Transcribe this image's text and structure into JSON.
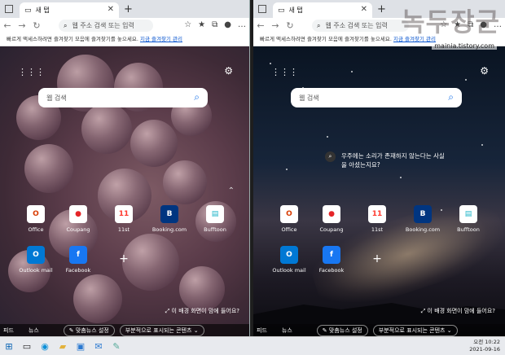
{
  "tab_title": "새 탭",
  "address_placeholder": "웹 주소 검색 또는 입력",
  "favbar_text": "빠르게 액세스하려면 즐겨찾기 모음에 즐겨찾기를 놓으세요. ",
  "favbar_link": "지금 즐겨찾기 관리",
  "search_placeholder": "웹 검색",
  "tiles": [
    {
      "label": "Office",
      "icon": "office-icon",
      "color": "#d83b01",
      "glyph": "O"
    },
    {
      "label": "Coupang",
      "icon": "coupang-icon",
      "color": "#e52528",
      "glyph": "●"
    },
    {
      "label": "11st",
      "icon": "11st-icon",
      "color": "#ff3b30",
      "glyph": "11"
    },
    {
      "label": "Booking.com",
      "icon": "booking-icon",
      "color": "#003580",
      "glyph": "B"
    },
    {
      "label": "Bufftoon",
      "icon": "bufftoon-icon",
      "color": "#1fb5c8",
      "glyph": "▤"
    },
    {
      "label": "Outlook mail",
      "icon": "outlook-icon",
      "color": "#0078d4",
      "glyph": "O"
    },
    {
      "label": "Facebook",
      "icon": "facebook-icon",
      "color": "#1877f2",
      "glyph": "f"
    }
  ],
  "caption": "이 배경 화면이 맘에 들어요?",
  "fact_line1": "우주에는 소리가 존재하지 않는다는 사실",
  "fact_line2": "을 아셨는지요?",
  "feed": {
    "feed": "피드",
    "news": "뉴스",
    "personalized": "맞춤뉴스 설정",
    "partial": "부분적으로 표시되는 콘텐츠"
  },
  "watermark": "녹두장군",
  "watermark_url": "mainia.tistory.com",
  "tray": {
    "time": "오전 10:22",
    "date": "2021-09-16"
  }
}
